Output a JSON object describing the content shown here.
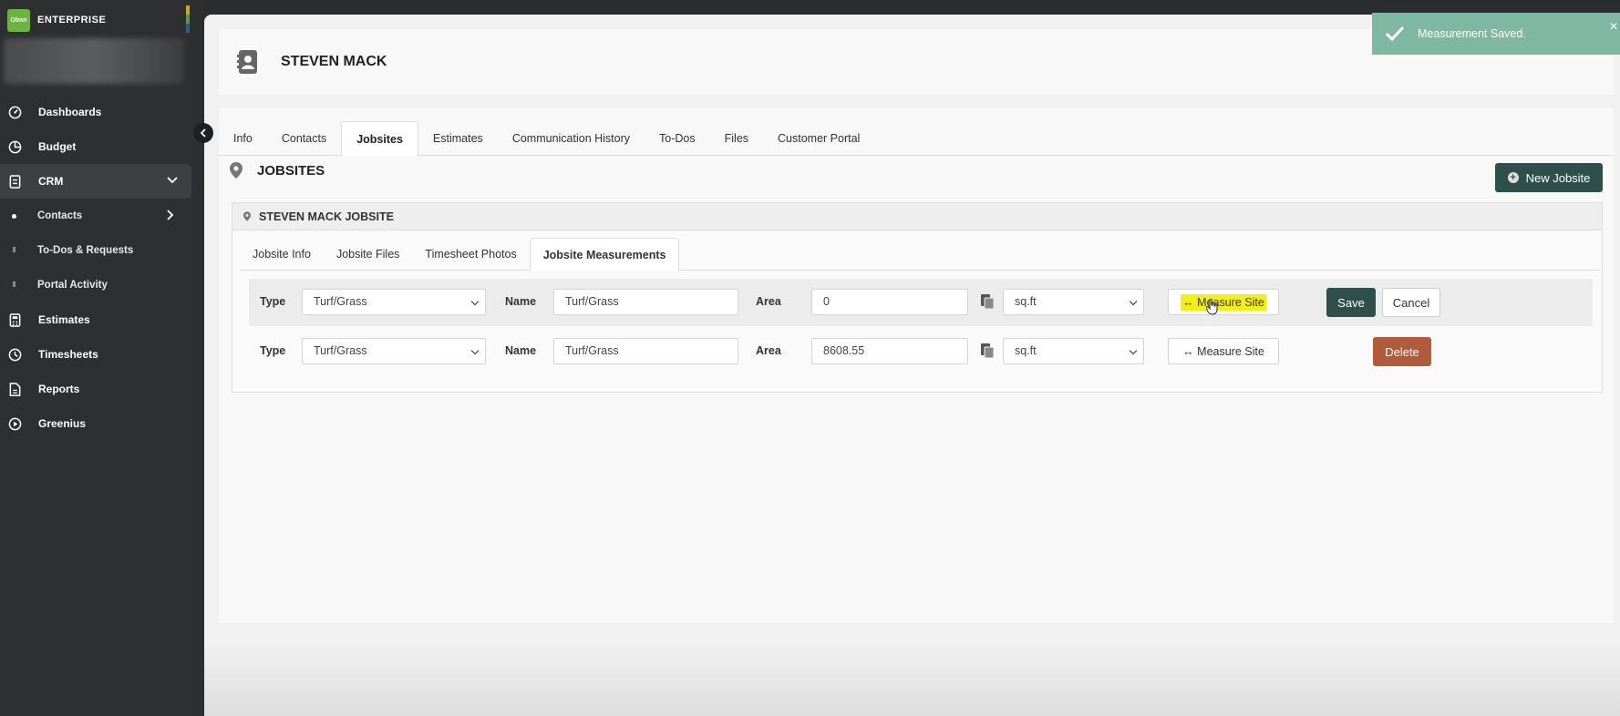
{
  "brand": {
    "logo": "Olmn",
    "name": "ENTERPRISE"
  },
  "sidebar": {
    "items": [
      {
        "label": "Dashboards",
        "icon": "dashboard-icon"
      },
      {
        "label": "Budget",
        "icon": "pie-chart-icon"
      },
      {
        "label": "CRM",
        "icon": "crm-icon"
      },
      {
        "label": "Estimates",
        "icon": "calculator-icon"
      },
      {
        "label": "Timesheets",
        "icon": "clock-icon"
      },
      {
        "label": "Reports",
        "icon": "report-icon"
      },
      {
        "label": "Greenius",
        "icon": "play-circle-icon"
      }
    ],
    "crm_sub": [
      {
        "label": "Contacts"
      },
      {
        "label": "To-Dos & Requests"
      },
      {
        "label": "Portal Activity"
      }
    ]
  },
  "header": {
    "title": "STEVEN MACK"
  },
  "tabs": [
    "Info",
    "Contacts",
    "Jobsites",
    "Estimates",
    "Communication History",
    "To-Dos",
    "Files",
    "Customer Portal"
  ],
  "section": {
    "title": "JOBSITES",
    "new_button": "New Jobsite"
  },
  "jobsite": {
    "title": "STEVEN MACK JOBSITE",
    "subtabs": [
      "Jobsite Info",
      "Jobsite Files",
      "Timesheet Photos",
      "Jobsite Measurements"
    ]
  },
  "measurements": {
    "type_label": "Type",
    "name_label": "Name",
    "area_label": "Area",
    "measure_label": "Measure Site",
    "measure_arrow": "↔",
    "rows": [
      {
        "type": "Turf/Grass",
        "name": "Turf/Grass",
        "area": "0",
        "unit": "sq.ft"
      },
      {
        "type": "Turf/Grass",
        "name": "Turf/Grass",
        "area": "8608.55",
        "unit": "sq.ft"
      }
    ],
    "save": "Save",
    "cancel": "Cancel",
    "delete": "Delete"
  },
  "toast": {
    "message": "Measurement Saved."
  },
  "colors": {
    "primary": "#2f4f4a",
    "danger": "#b25a3c",
    "toast": "#7fb8a2",
    "highlight": "#f3ef12",
    "brand_green": "#6db33f"
  }
}
